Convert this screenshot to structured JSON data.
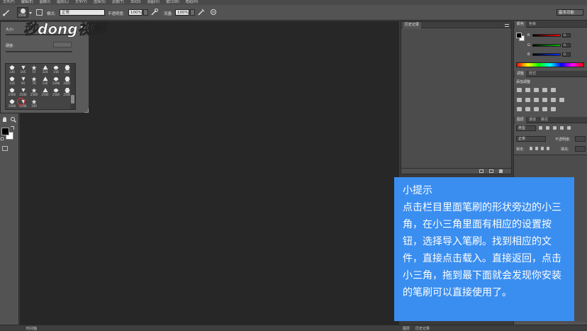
{
  "menubar": {
    "items": [
      "文件(F)",
      "编辑(E)",
      "图像(I)",
      "图层(L)",
      "文字(Y)",
      "选择(S)",
      "滤镜(T)",
      "3D(D)",
      "视图(V)",
      "窗口(W)",
      "帮助(H)"
    ]
  },
  "options": {
    "brush_size": "2500",
    "mode_label": "模式:",
    "mode_value": "正常",
    "opacity_label": "不透明度:",
    "opacity_value": "100%",
    "flow_label": "流量:",
    "flow_value": "100%",
    "workspace": "基本功能"
  },
  "brush_panel": {
    "size_label": "大小:",
    "hardness_label": "硬度:",
    "brushes": [
      {
        "n": "136"
      },
      {
        "n": "105"
      },
      {
        "n": "57"
      },
      {
        "n": "324"
      },
      {
        "n": "156"
      },
      {
        "n": "104"
      },
      {
        "n": "116"
      },
      {
        "n": "94"
      },
      {
        "n": "76"
      },
      {
        "n": "116"
      },
      {
        "n": "2298"
      },
      {
        "n": "2487"
      },
      {
        "n": "2500"
      },
      {
        "n": "2500"
      },
      {
        "n": "2500"
      },
      {
        "n": "2500"
      },
      {
        "n": "2500"
      },
      {
        "n": "2500"
      },
      {
        "n": "2500"
      },
      {
        "n": "2500"
      },
      {
        "n": "100"
      }
    ]
  },
  "history_panel": {
    "tab": "历史记录"
  },
  "color_panel": {
    "tabs": [
      "颜色",
      "色板"
    ],
    "r_label": "R",
    "g_label": "G",
    "b_label": "B",
    "r_value": "0",
    "g_value": "0",
    "b_value": "0"
  },
  "adjust_panel": {
    "tabs": [
      "调整",
      "样式"
    ],
    "title": "添加调整"
  },
  "layers_panel": {
    "tabs": [
      "图层",
      "通道",
      "路径"
    ],
    "kind": "类型",
    "blend": "正常",
    "opacity_label": "不透明度:",
    "lock_label": "锁定:",
    "fill_label": "填充:"
  },
  "bottom": {
    "left_tab": "时间轴",
    "right_tab1": "图层",
    "right_tab2": "历史记录"
  },
  "watermark": {
    "text": "秒dong视频"
  },
  "tips": {
    "title": "小提示",
    "body": "点击栏目里面笔刷的形状旁边的小三角，在小三角里面有相应的设置按钮，选择导入笔刷。找到相应的文件，直接点击载入。直接返回，点击小三角，拖到最下面就会发现你安装的笔刷可以直接使用了。",
    "background": "#3a8ef0"
  }
}
